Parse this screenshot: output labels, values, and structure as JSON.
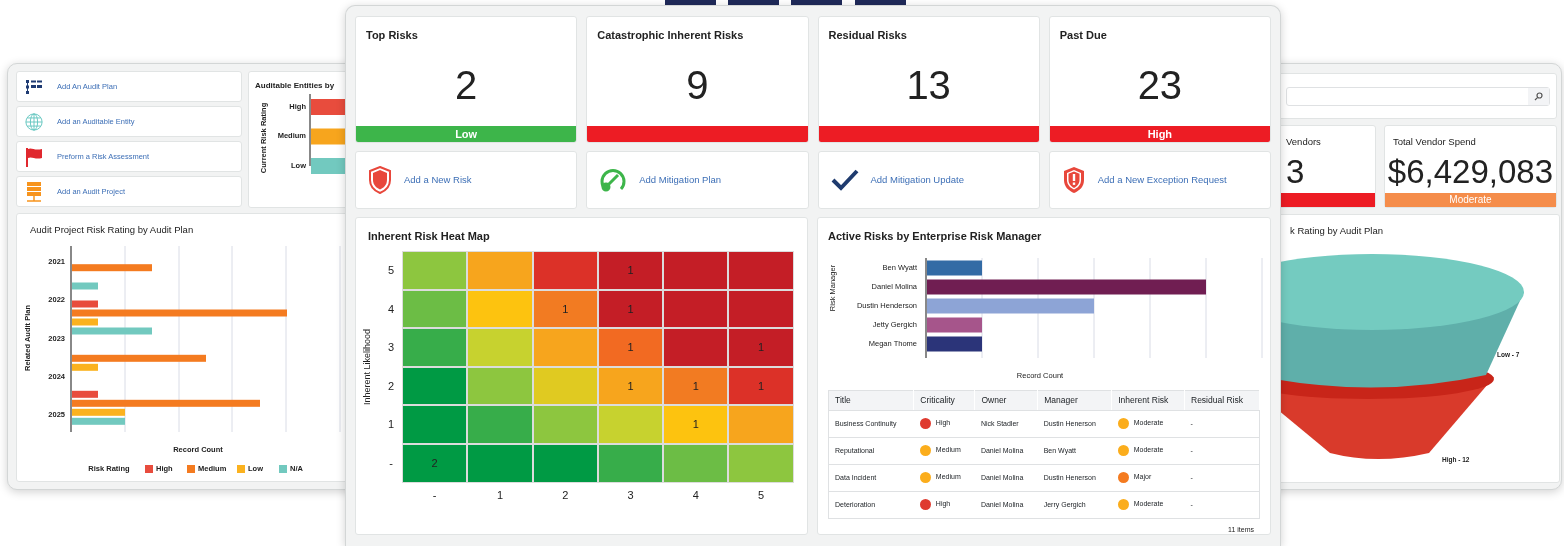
{
  "left_window": {
    "actions": [
      {
        "label": "Add An Audit Plan",
        "kind": "list"
      },
      {
        "label": "Add an Auditable Entity",
        "kind": "globe"
      },
      {
        "label": "Preform a Risk Assessment",
        "kind": "flag"
      },
      {
        "label": "Add an Audit Project",
        "kind": "server"
      }
    ],
    "entities_chart": {
      "title": "Auditable Entities by",
      "ylabel": "Current Risk Rating",
      "categories": [
        {
          "label": "High",
          "color": "#e84c3d"
        },
        {
          "label": "Medium",
          "color": "#f7a51d"
        },
        {
          "label": "Low",
          "color": "#72c9bf"
        }
      ]
    },
    "audit_chart": {
      "title": "Audit Project Risk Rating by Audit Plan",
      "ylabel": "Related Audit Plan",
      "xlabel": "Record Count",
      "categories": [
        "2021",
        "2022",
        "2023",
        "2024",
        "2025"
      ],
      "legend_title": "Risk Rating",
      "legend": [
        {
          "label": "High",
          "color": "#e84c3d"
        },
        {
          "label": "Medium",
          "color": "#f47b20"
        },
        {
          "label": "Low",
          "color": "#fbb21f"
        },
        {
          "label": "N/A",
          "color": "#72c9bf"
        }
      ]
    }
  },
  "center_window": {
    "kpis": [
      {
        "title": "Top Risks",
        "value": "2",
        "status": "Low",
        "color": "#3db54a"
      },
      {
        "title": "Catastrophic Inherent Risks",
        "value": "9",
        "color": "#ed1c24"
      },
      {
        "title": "Residual Risks",
        "value": "13",
        "color": "#ed1c24"
      },
      {
        "title": "Past Due",
        "value": "23",
        "status": "High",
        "color": "#ed1c24"
      }
    ],
    "actions": [
      {
        "label": "Add a New Risk",
        "kind": "shield"
      },
      {
        "label": "Add Mitigation Plan",
        "kind": "gauge"
      },
      {
        "label": "Add Mitigation Update",
        "kind": "check"
      },
      {
        "label": "Add a New Exception Request",
        "kind": "alert"
      }
    ],
    "heat_map": {
      "title": "Inherent Risk Heat Map",
      "ylabel": "Inherent Likelihood",
      "ylabels": [
        "5",
        "4",
        "3",
        "2",
        "1",
        "-"
      ],
      "xlabels": [
        "-",
        "1",
        "2",
        "3",
        "4",
        "5"
      ],
      "rows": [
        [
          {
            "color": "#8dc63f"
          },
          {
            "color": "#f7a51d"
          },
          {
            "color": "#dc3128"
          },
          {
            "color": "#c41e26",
            "value": "1"
          },
          {
            "color": "#c41e26"
          },
          {
            "color": "#c41e26"
          }
        ],
        [
          {
            "color": "#6cbd45"
          },
          {
            "color": "#fdc30f"
          },
          {
            "color": "#f27b22",
            "value": "1"
          },
          {
            "color": "#c41e26",
            "value": "1"
          },
          {
            "color": "#c41e26"
          },
          {
            "color": "#c41e26"
          }
        ],
        [
          {
            "color": "#37ad4a"
          },
          {
            "color": "#c7d22f"
          },
          {
            "color": "#f7a51d"
          },
          {
            "color": "#f26a22",
            "value": "1"
          },
          {
            "color": "#c41e26"
          },
          {
            "color": "#c41e26",
            "value": "1"
          }
        ],
        [
          {
            "color": "#009a44"
          },
          {
            "color": "#8dc63f"
          },
          {
            "color": "#e0ca21"
          },
          {
            "color": "#f7a51d",
            "value": "1"
          },
          {
            "color": "#f27b22",
            "value": "1"
          },
          {
            "color": "#dc3128",
            "value": "1"
          }
        ],
        [
          {
            "color": "#009a44"
          },
          {
            "color": "#37ad4a"
          },
          {
            "color": "#8dc63f"
          },
          {
            "color": "#c7d22f"
          },
          {
            "color": "#fdc30f",
            "value": "1"
          },
          {
            "color": "#f7a51d"
          }
        ],
        [
          {
            "color": "#009a44",
            "value": "2"
          },
          {
            "color": "#009a44"
          },
          {
            "color": "#009a44"
          },
          {
            "color": "#37ad4a"
          },
          {
            "color": "#6cbd45"
          },
          {
            "color": "#8dc63f"
          }
        ]
      ]
    },
    "active_risks": {
      "title": "Active Risks by Enterprise Risk Manager",
      "ylabel": "Risk Manager",
      "xlabel": "Record Count",
      "managers": [
        {
          "name": "Ben Wyatt",
          "color": "#336ba5"
        },
        {
          "name": "Daniel Molina",
          "color": "#701e52"
        },
        {
          "name": "Dustin Henderson",
          "color": "#8da4d6"
        },
        {
          "name": "Jetty Gergich",
          "color": "#a6558b"
        },
        {
          "name": "Megan Thome",
          "color": "#2b3479"
        }
      ],
      "table": {
        "columns": [
          "Title",
          "Criticality",
          "Owner",
          "Manager",
          "Inherent Risk",
          "Residual Risk"
        ],
        "rows": [
          {
            "title": "Business Continuity",
            "criticality": {
              "text": "High",
              "color": "#df3a2f"
            },
            "owner": "Nick Stadler",
            "manager": "Dustin Henerson",
            "inherent_risk": {
              "text": "Moderate",
              "color": "#fbad1c"
            },
            "residual_risk": "-"
          },
          {
            "title": "Reputational",
            "criticality": {
              "text": "Medium",
              "color": "#fbad1c"
            },
            "owner": "Daniel Molina",
            "manager": "Ben Wyatt",
            "inherent_risk": {
              "text": "Moderate",
              "color": "#fbad1c"
            },
            "residual_risk": "-"
          },
          {
            "title": "Data Incident",
            "criticality": {
              "text": "Medium",
              "color": "#fbad1c"
            },
            "owner": "Daniel Molina",
            "manager": "Dustin Henerson",
            "inherent_risk": {
              "text": "Major",
              "color": "#f47b20"
            },
            "residual_risk": "-"
          },
          {
            "title": "Deterioration",
            "criticality": {
              "text": "High",
              "color": "#df3a2f"
            },
            "owner": "Daniel Molina",
            "manager": "Jerry Gergich",
            "inherent_risk": {
              "text": "Moderate",
              "color": "#fbad1c"
            },
            "residual_risk": "-"
          }
        ]
      },
      "footer": "11 items"
    }
  },
  "right_window": {
    "kpis": [
      {
        "title": "Vendors",
        "value": "3",
        "color": "#ed1c24"
      },
      {
        "title": "Total Vendor Spend",
        "value": "$6,429,083",
        "status": "Moderate",
        "color": "#f58d4b"
      }
    ],
    "funnel": {
      "title": "k Rating by Audit Plan",
      "labels": [
        "Low - 7",
        "High - 12"
      ]
    }
  }
}
